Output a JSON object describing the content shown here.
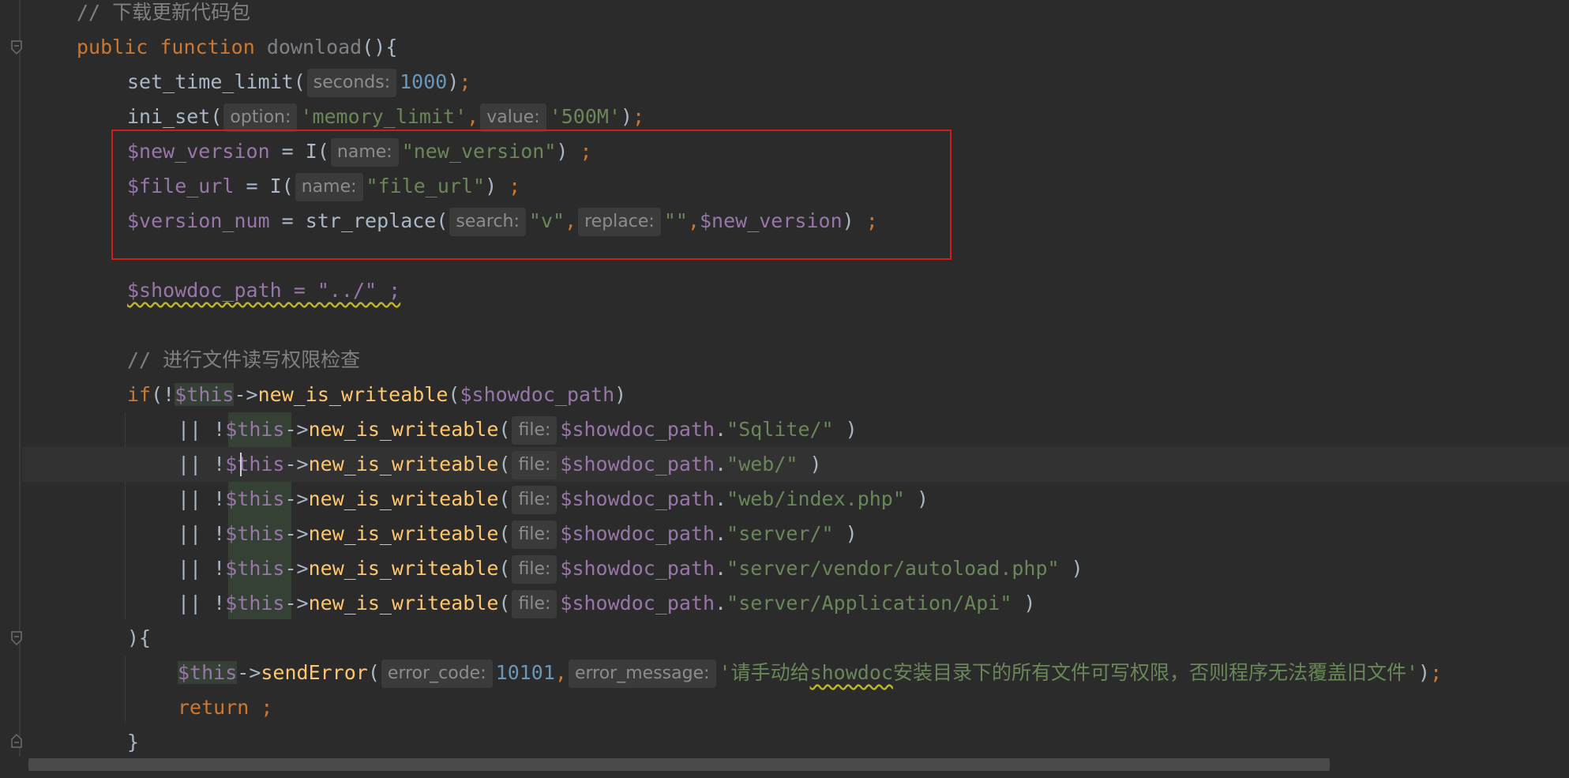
{
  "editor": {
    "lines": [
      {
        "id": "l1",
        "segments": [
          {
            "t": "// 下载更新代码包",
            "c": "comment"
          }
        ]
      },
      {
        "id": "l2",
        "segments": [
          {
            "t": "public ",
            "c": "kw"
          },
          {
            "t": "function ",
            "c": "kw"
          },
          {
            "t": "download",
            "c": "fn-name-decl"
          },
          {
            "t": "(){",
            "c": "punct"
          }
        ]
      },
      {
        "id": "l3",
        "segments": [
          {
            "t": "set_time_limit(",
            "c": "punct"
          },
          {
            "hint": "seconds:"
          },
          {
            "t": "1000",
            "c": "num"
          },
          {
            "t": ")",
            "c": "punct"
          },
          {
            "t": ";",
            "c": "semi"
          }
        ]
      },
      {
        "id": "l4",
        "segments": [
          {
            "t": "ini_set(",
            "c": "punct"
          },
          {
            "hint": "option:"
          },
          {
            "t": "'memory_limit'",
            "c": "str"
          },
          {
            "t": ",",
            "c": "semi"
          },
          {
            "hint": "value:"
          },
          {
            "t": "'500M'",
            "c": "str"
          },
          {
            "t": ")",
            "c": "punct"
          },
          {
            "t": ";",
            "c": "semi"
          }
        ]
      },
      {
        "id": "l5",
        "segments": [
          {
            "t": "$new_version",
            "c": "var"
          },
          {
            "t": " = I(",
            "c": "punct"
          },
          {
            "hint": "name:"
          },
          {
            "t": "\"new_version\"",
            "c": "str"
          },
          {
            "t": ") ",
            "c": "punct"
          },
          {
            "t": ";",
            "c": "semi"
          }
        ]
      },
      {
        "id": "l6",
        "segments": [
          {
            "t": "$file_url",
            "c": "var"
          },
          {
            "t": " = I(",
            "c": "punct"
          },
          {
            "hint": "name:"
          },
          {
            "t": "\"file_url\"",
            "c": "str"
          },
          {
            "t": ") ",
            "c": "punct"
          },
          {
            "t": ";",
            "c": "semi"
          }
        ]
      },
      {
        "id": "l7",
        "segments": [
          {
            "t": "$version_num",
            "c": "var"
          },
          {
            "t": " = str_replace(",
            "c": "punct"
          },
          {
            "hint": "search:"
          },
          {
            "t": "\"v\"",
            "c": "str"
          },
          {
            "t": ",",
            "c": "semi"
          },
          {
            "hint": "replace:"
          },
          {
            "t": "\"\"",
            "c": "str"
          },
          {
            "t": ",",
            "c": "semi"
          },
          {
            "t": "$new_version",
            "c": "var"
          },
          {
            "t": ") ",
            "c": "punct"
          },
          {
            "t": ";",
            "c": "semi"
          }
        ]
      },
      {
        "id": "l8",
        "segments": []
      },
      {
        "id": "l9",
        "segments": [
          {
            "t": "$showdoc_path = \"../\" ;",
            "c": "squiggle-line"
          }
        ]
      },
      {
        "id": "l10",
        "segments": []
      },
      {
        "id": "l11",
        "segments": [
          {
            "t": "// 进行文件读写权限检查",
            "c": "comment"
          }
        ]
      },
      {
        "id": "l12",
        "segments": [
          {
            "t": "if",
            "c": "kw"
          },
          {
            "t": "(!",
            "c": "punct"
          },
          {
            "t": "$this",
            "c": "var this-hl"
          },
          {
            "t": "->",
            "c": "punct"
          },
          {
            "t": "new_is_writeable",
            "c": "fn"
          },
          {
            "t": "(",
            "c": "punct"
          },
          {
            "t": "$showdoc_path",
            "c": "var"
          },
          {
            "t": ")",
            "c": "punct"
          }
        ]
      },
      {
        "id": "l13",
        "segments": [
          {
            "t": "|| !",
            "c": "punct"
          },
          {
            "t": "$this",
            "c": "var"
          },
          {
            "t": "->",
            "c": "punct"
          },
          {
            "t": "new_is_writeable",
            "c": "fn"
          },
          {
            "t": "(",
            "c": "punct"
          },
          {
            "hint": "file:"
          },
          {
            "t": "$showdoc_path",
            "c": "var"
          },
          {
            "t": ".",
            "c": "punct"
          },
          {
            "t": "\"Sqlite/\"",
            "c": "str"
          },
          {
            "t": " )",
            "c": "punct"
          }
        ]
      },
      {
        "id": "l14",
        "segments": [
          {
            "t": "|| !",
            "c": "punct"
          },
          {
            "t": "$this",
            "c": "var"
          },
          {
            "t": "->",
            "c": "punct"
          },
          {
            "t": "new_is_writeable",
            "c": "fn"
          },
          {
            "t": "(",
            "c": "punct"
          },
          {
            "hint": "file:"
          },
          {
            "t": "$showdoc_path",
            "c": "var"
          },
          {
            "t": ".",
            "c": "punct"
          },
          {
            "t": "\"web/\"",
            "c": "str"
          },
          {
            "t": " )",
            "c": "punct"
          }
        ]
      },
      {
        "id": "l15",
        "segments": [
          {
            "t": "|| !",
            "c": "punct"
          },
          {
            "t": "$this",
            "c": "var"
          },
          {
            "t": "->",
            "c": "punct"
          },
          {
            "t": "new_is_writeable",
            "c": "fn"
          },
          {
            "t": "(",
            "c": "punct"
          },
          {
            "hint": "file:"
          },
          {
            "t": "$showdoc_path",
            "c": "var"
          },
          {
            "t": ".",
            "c": "punct"
          },
          {
            "t": "\"web/index.php\"",
            "c": "str"
          },
          {
            "t": " )",
            "c": "punct"
          }
        ]
      },
      {
        "id": "l16",
        "segments": [
          {
            "t": "|| !",
            "c": "punct"
          },
          {
            "t": "$this",
            "c": "var"
          },
          {
            "t": "->",
            "c": "punct"
          },
          {
            "t": "new_is_writeable",
            "c": "fn"
          },
          {
            "t": "(",
            "c": "punct"
          },
          {
            "hint": "file:"
          },
          {
            "t": "$showdoc_path",
            "c": "var"
          },
          {
            "t": ".",
            "c": "punct"
          },
          {
            "t": "\"server/\"",
            "c": "str"
          },
          {
            "t": " )",
            "c": "punct"
          }
        ]
      },
      {
        "id": "l17",
        "segments": [
          {
            "t": "|| !",
            "c": "punct"
          },
          {
            "t": "$this",
            "c": "var"
          },
          {
            "t": "->",
            "c": "punct"
          },
          {
            "t": "new_is_writeable",
            "c": "fn"
          },
          {
            "t": "(",
            "c": "punct"
          },
          {
            "hint": "file:"
          },
          {
            "t": "$showdoc_path",
            "c": "var"
          },
          {
            "t": ".",
            "c": "punct"
          },
          {
            "t": "\"server/vendor/autoload.php\"",
            "c": "str"
          },
          {
            "t": " )",
            "c": "punct"
          }
        ]
      },
      {
        "id": "l18",
        "segments": [
          {
            "t": "|| !",
            "c": "punct"
          },
          {
            "t": "$this",
            "c": "var"
          },
          {
            "t": "->",
            "c": "punct"
          },
          {
            "t": "new_is_writeable",
            "c": "fn"
          },
          {
            "t": "(",
            "c": "punct"
          },
          {
            "hint": "file:"
          },
          {
            "t": "$showdoc_path",
            "c": "var"
          },
          {
            "t": ".",
            "c": "punct"
          },
          {
            "t": "\"server/Application/Api\"",
            "c": "str"
          },
          {
            "t": " )",
            "c": "punct"
          }
        ]
      },
      {
        "id": "l19",
        "segments": [
          {
            "t": "){",
            "c": "punct"
          }
        ]
      },
      {
        "id": "l20",
        "segments": [
          {
            "t": "$this",
            "c": "var this-hl"
          },
          {
            "t": "->",
            "c": "punct"
          },
          {
            "t": "sendError",
            "c": "fn"
          },
          {
            "t": "(",
            "c": "punct"
          },
          {
            "hint": "error_code:"
          },
          {
            "t": "10101",
            "c": "num"
          },
          {
            "t": ",",
            "c": "semi"
          },
          {
            "hint": "error_message:"
          },
          {
            "t": "'请手动给",
            "c": "str"
          },
          {
            "t": "showdoc",
            "c": "str squiggle-word"
          },
          {
            "t": "安装目录下的所有文件可写权限，否则程序无法覆盖旧文件'",
            "c": "str"
          },
          {
            "t": ")",
            "c": "punct"
          },
          {
            "t": ";",
            "c": "semi"
          }
        ]
      },
      {
        "id": "l21",
        "segments": [
          {
            "t": "return ",
            "c": "kw"
          },
          {
            "t": ";",
            "c": "semi"
          }
        ]
      },
      {
        "id": "l22",
        "segments": [
          {
            "t": "}",
            "c": "punct"
          }
        ]
      }
    ],
    "icons": {
      "bulb": "lightbulb-icon",
      "fold": "fold-marker-icon"
    },
    "colors": {
      "background": "#2b2b2b",
      "keyword": "#cc7832",
      "string": "#6a8759",
      "variable": "#9876aa",
      "function": "#ffc66d",
      "number": "#6897bb",
      "comment": "#808080",
      "selection_border": "#d21c1c"
    }
  }
}
